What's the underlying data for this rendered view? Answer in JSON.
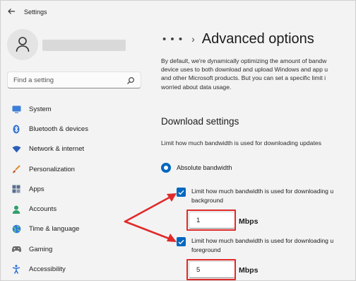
{
  "window": {
    "title": "Settings",
    "back_icon": "back-arrow-icon"
  },
  "search": {
    "placeholder": "Find a setting",
    "icon": "search-icon"
  },
  "sidebar": {
    "items": [
      {
        "label": "System",
        "icon": "monitor-icon",
        "color": "#3b7fd6"
      },
      {
        "label": "Bluetooth & devices",
        "icon": "bluetooth-icon",
        "color": "#2f6fd1"
      },
      {
        "label": "Network & internet",
        "icon": "wifi-icon",
        "color": "#2a5fb8"
      },
      {
        "label": "Personalization",
        "icon": "brush-icon",
        "color": "#e08a2e"
      },
      {
        "label": "Apps",
        "icon": "apps-icon",
        "color": "#5a6e8c"
      },
      {
        "label": "Accounts",
        "icon": "person-icon",
        "color": "#2fa06a"
      },
      {
        "label": "Time & language",
        "icon": "globe-icon",
        "color": "#2f7fd6"
      },
      {
        "label": "Gaming",
        "icon": "gamepad-icon",
        "color": "#6a6a6a"
      },
      {
        "label": "Accessibility",
        "icon": "accessibility-icon",
        "color": "#2a6fd6"
      }
    ]
  },
  "main": {
    "breadcrumb_ellipsis": "• • •",
    "breadcrumb_separator": "›",
    "page_title": "Advanced options",
    "description_lines": [
      "By default, we're dynamically optimizing the amount of bandw",
      "device uses to both download and upload Windows and app u",
      "and other Microsoft products. But you can set a specific limit i",
      "worried about data usage."
    ],
    "download_settings": {
      "title": "Download settings",
      "limit_text": "Limit how much bandwidth is used for downloading updates",
      "radio_label": "Absolute bandwidth",
      "background": {
        "checkbox_line1": "Limit how much bandwidth is used for downloading u",
        "checkbox_line2": "background",
        "value": "1",
        "unit": "Mbps"
      },
      "foreground": {
        "checkbox_line1": "Limit how much bandwidth is used for downloading u",
        "checkbox_line2": "foreground",
        "value": "5",
        "unit": "Mbps"
      }
    }
  },
  "colors": {
    "accent": "#0067c0",
    "annotation": "#e02a2a"
  }
}
